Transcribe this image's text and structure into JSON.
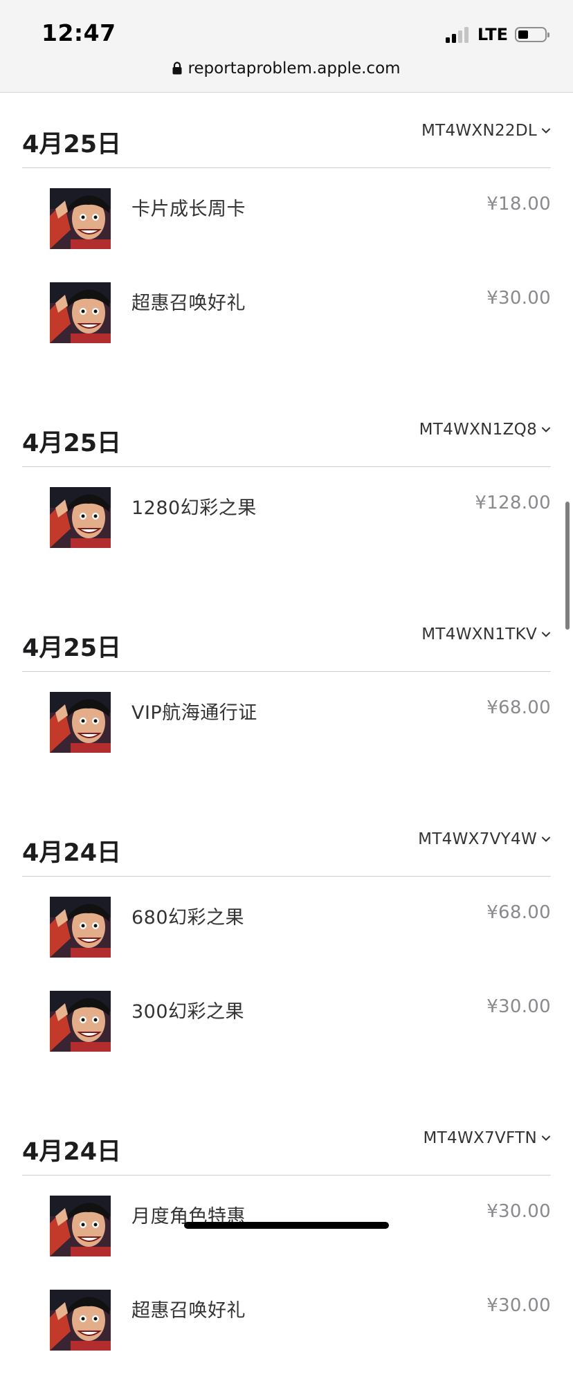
{
  "status_bar": {
    "time": "12:47",
    "network": "LTE"
  },
  "browser": {
    "url": "reportaproblem.apple.com"
  },
  "colors": {
    "price": "#8a8a8e",
    "divider": "#d2d2d7",
    "scrollbar": "#7f7f7f"
  },
  "purchases": [
    {
      "date": "4月25日",
      "order_id": "MT4WXN22DL",
      "items": [
        {
          "name": "卡片成长周卡",
          "price": "¥18.00",
          "icon": "app-icon"
        },
        {
          "name": "超惠召唤好礼",
          "price": "¥30.00",
          "icon": "app-icon"
        }
      ]
    },
    {
      "date": "4月25日",
      "order_id": "MT4WXN1ZQ8",
      "items": [
        {
          "name": "1280幻彩之果",
          "price": "¥128.00",
          "icon": "app-icon"
        }
      ]
    },
    {
      "date": "4月25日",
      "order_id": "MT4WXN1TKV",
      "items": [
        {
          "name": "VIP航海通行证",
          "price": "¥68.00",
          "icon": "app-icon"
        }
      ]
    },
    {
      "date": "4月24日",
      "order_id": "MT4WX7VY4W",
      "items": [
        {
          "name": "680幻彩之果",
          "price": "¥68.00",
          "icon": "app-icon"
        },
        {
          "name": "300幻彩之果",
          "price": "¥30.00",
          "icon": "app-icon"
        }
      ]
    },
    {
      "date": "4月24日",
      "order_id": "MT4WX7VFTN",
      "items": [
        {
          "name": "月度角色特惠",
          "price": "¥30.00",
          "icon": "app-icon"
        },
        {
          "name": "超惠召唤好礼",
          "price": "¥30.00",
          "icon": "app-icon"
        }
      ]
    }
  ]
}
